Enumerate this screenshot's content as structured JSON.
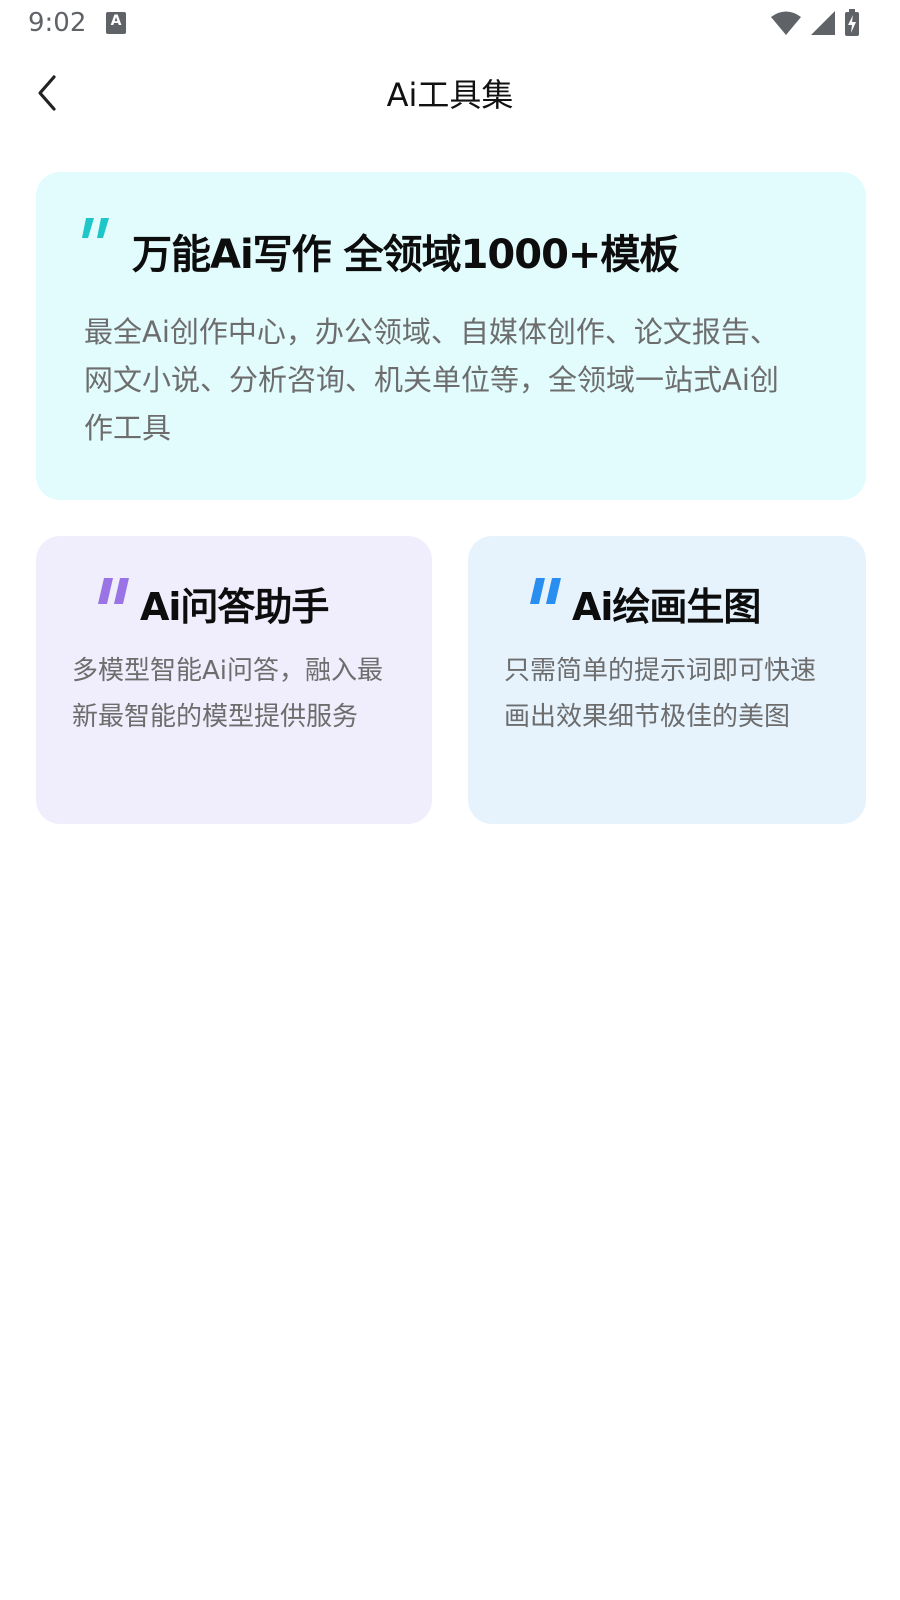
{
  "status_bar": {
    "time": "9:02",
    "notification_icon": "a-notification-icon",
    "icons": [
      "wifi-icon",
      "signal-icon",
      "battery-charging-icon"
    ]
  },
  "header": {
    "back_icon": "chevron-left-icon",
    "title": "Ai工具集"
  },
  "cards": {
    "writing": {
      "title": "万能Ai写作 全领域1000+模板",
      "description": "最全Ai创作中心，办公领域、自媒体创作、论文报告、网文小说、分析咨询、机关单位等，全领域一站式Ai创作工具",
      "accent_color": "#1fc6c8",
      "background_color": "#e2fcfd"
    },
    "qa": {
      "title": "Ai问答助手",
      "description": "多模型智能Ai问答，融入最新最智能的模型提供服务",
      "accent_color": "#9a73e6",
      "background_color": "#f0eefc"
    },
    "drawing": {
      "title": "Ai绘画生图",
      "description": "只需简单的提示词即可快速画出效果细节极佳的美图",
      "accent_color": "#2a8ef0",
      "background_color": "#e6f3fd"
    }
  }
}
